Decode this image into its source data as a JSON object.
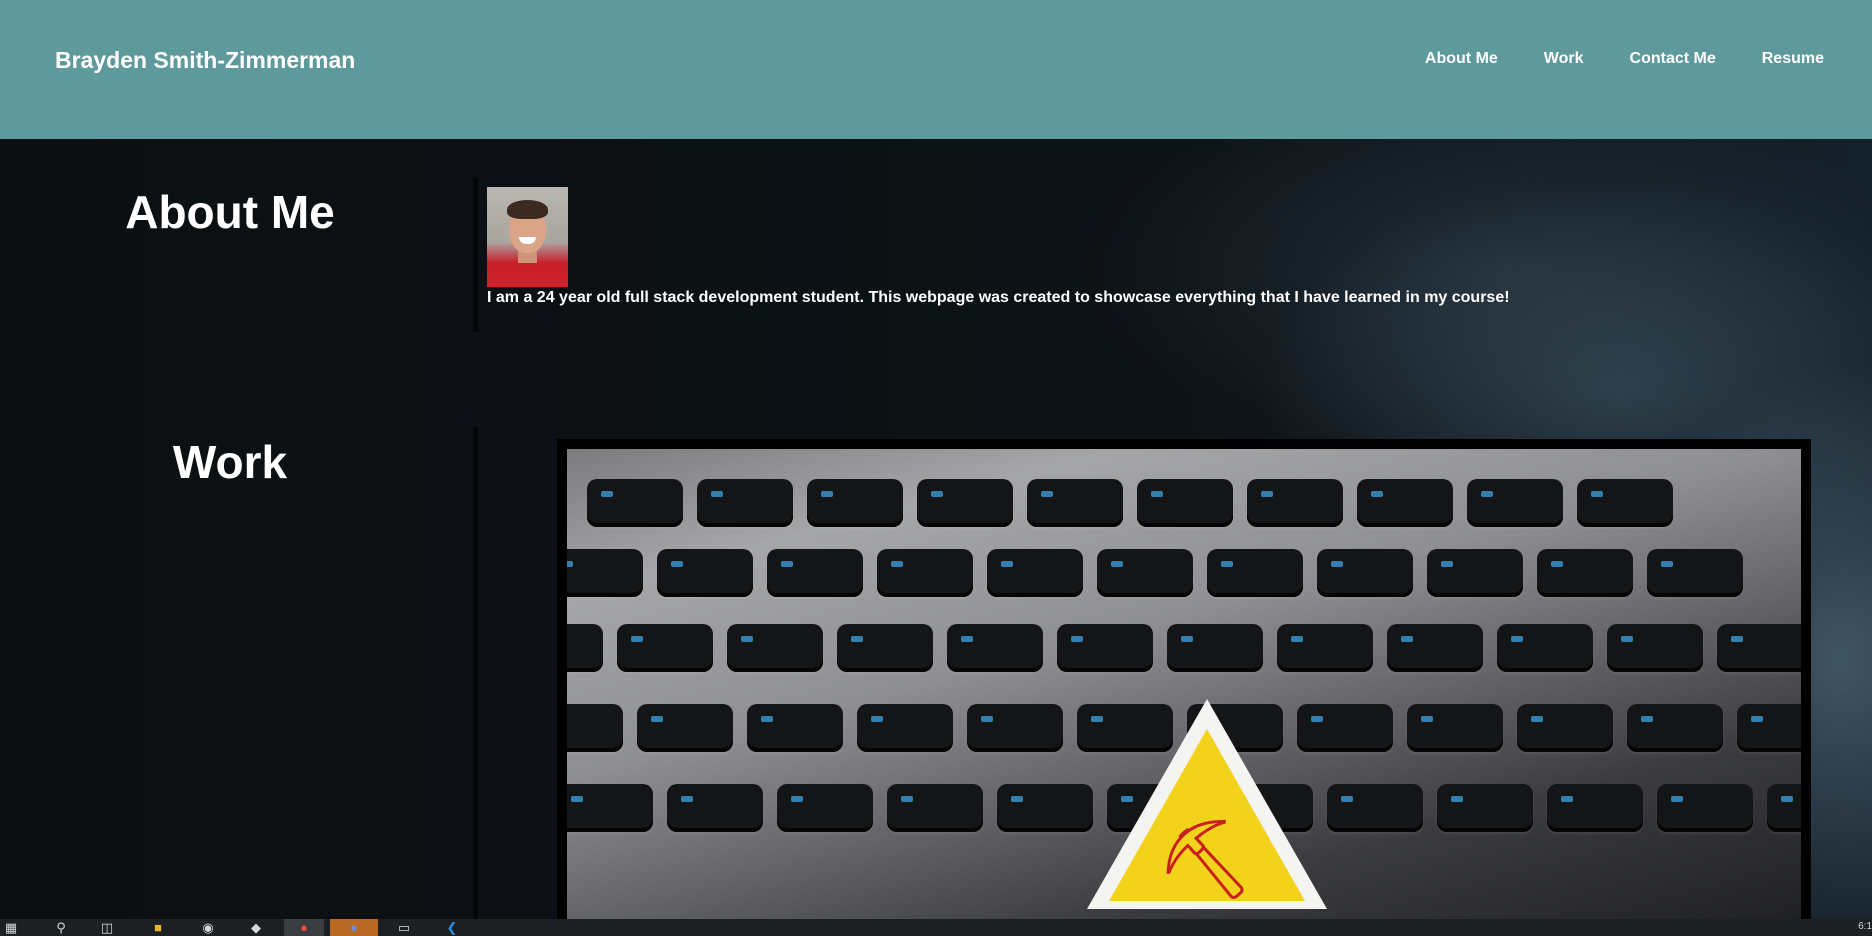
{
  "header": {
    "brand": "Brayden Smith-Zimmerman",
    "nav": [
      "About Me",
      "Work",
      "Contact Me",
      "Resume"
    ]
  },
  "about": {
    "title": "About Me",
    "text": "I am a 24 year old full stack development student. This webpage was created to showcase everything that I have learned in my course!"
  },
  "work": {
    "title": "Work"
  },
  "taskbar": {
    "icons": [
      "windows-icon",
      "search-icon",
      "task-view-icon",
      "file-explorer-icon",
      "app-icon",
      "pin-icon",
      "chrome-icon",
      "discord-icon",
      "terminal-icon",
      "vscode-icon"
    ],
    "clock": "6:1"
  },
  "colors": {
    "header_bg": "#5e9a9c",
    "page_bg": "#0d1114",
    "text": "#ffffff"
  }
}
